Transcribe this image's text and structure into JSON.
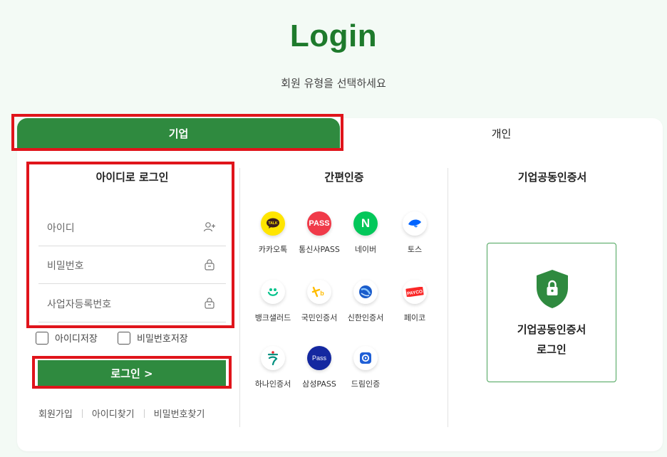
{
  "header": {
    "title": "Login",
    "subtitle": "회원 유형을 선택하세요"
  },
  "tabs": [
    {
      "label": "기업",
      "active": true
    },
    {
      "label": "개인",
      "active": false
    }
  ],
  "id_login": {
    "title": "아이디로 로그인",
    "fields": [
      {
        "placeholder": "아이디",
        "icon": "add-user-icon"
      },
      {
        "placeholder": "비밀번호",
        "icon": "lock-icon"
      },
      {
        "placeholder": "사업자등록번호",
        "icon": "lock-icon"
      }
    ],
    "checkboxes": [
      {
        "label": "아이디저장",
        "checked": false
      },
      {
        "label": "비밀번호저장",
        "checked": false
      }
    ],
    "login_button": "로그인 >",
    "links": [
      "회원가입",
      "아이디찾기",
      "비밀번호찾기"
    ]
  },
  "simple_auth": {
    "title": "간편인증",
    "items": [
      {
        "label": "카카오톡",
        "icon": "kakaotalk-icon",
        "color": "#ffe500"
      },
      {
        "label": "통신사PASS",
        "icon": "pass-icon",
        "color": "#f03a49"
      },
      {
        "label": "네이버",
        "icon": "naver-icon",
        "color": "#03c75a"
      },
      {
        "label": "토스",
        "icon": "toss-icon",
        "color": "#0064ff"
      },
      {
        "label": "뱅크샐러드",
        "icon": "banksalad-icon",
        "color": "#00c28a"
      },
      {
        "label": "국민인증서",
        "icon": "kb-icon",
        "color": "#ffbc00"
      },
      {
        "label": "신한인증서",
        "icon": "shinhan-icon",
        "color": "#1a5ccb"
      },
      {
        "label": "페이코",
        "icon": "payco-icon",
        "color": "#fa2828"
      },
      {
        "label": "하나인증서",
        "icon": "hana-icon",
        "color": "#00907f"
      },
      {
        "label": "삼성PASS",
        "icon": "samsung-pass-icon",
        "color": "#1428a0"
      },
      {
        "label": "드림인증",
        "icon": "dream-icon",
        "color": "#1f5fd6"
      }
    ]
  },
  "corp_cert": {
    "title": "기업공동인증서",
    "button_line1": "기업공동인증서",
    "button_line2": "로그인"
  },
  "colors": {
    "brand_green": "#2f8a3f",
    "title_green": "#1e7a2c",
    "highlight_red": "#e0141b"
  }
}
